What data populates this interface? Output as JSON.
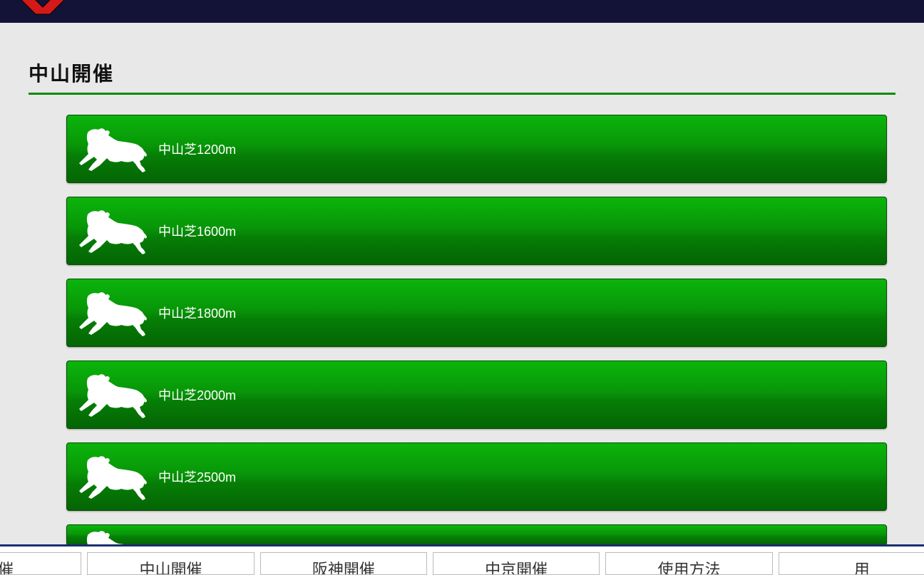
{
  "section": {
    "title": "中山開催"
  },
  "courses": [
    {
      "label": "中山芝1200m"
    },
    {
      "label": "中山芝1600m"
    },
    {
      "label": "中山芝1800m"
    },
    {
      "label": "中山芝2000m"
    },
    {
      "label": "中山芝2500m"
    },
    {
      "label": ""
    }
  ],
  "tabs": [
    {
      "label": "開催"
    },
    {
      "label": "中山開催"
    },
    {
      "label": "阪神開催"
    },
    {
      "label": "中京開催"
    },
    {
      "label": "使用方法"
    },
    {
      "label": "用"
    }
  ]
}
